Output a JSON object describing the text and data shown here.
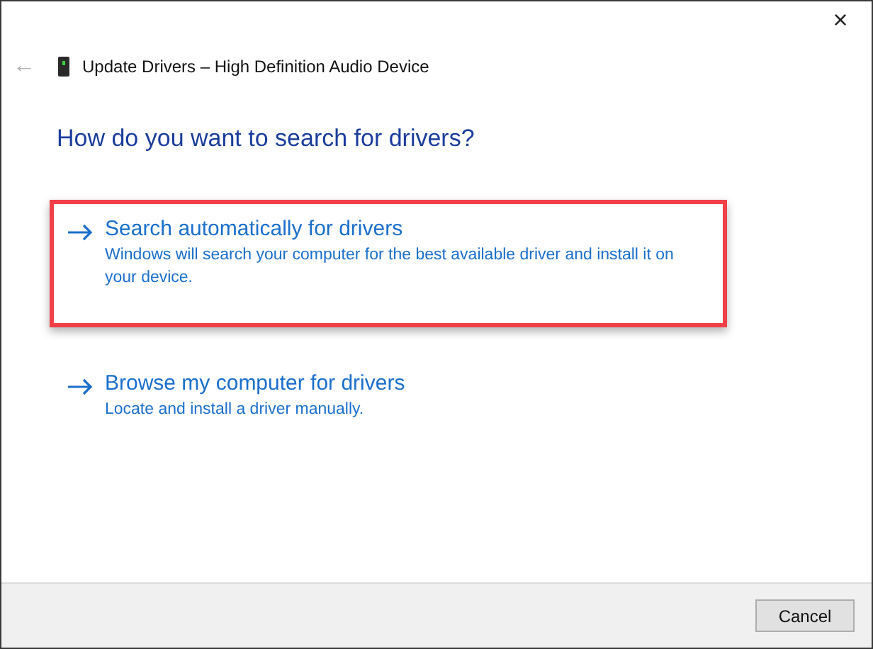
{
  "window": {
    "title": "Update Drivers – High Definition Audio Device",
    "close": "×",
    "back": "←"
  },
  "heading": "How do you want to search for drivers?",
  "options": [
    {
      "title": "Search automatically for drivers",
      "description": "Windows will search your computer for the best available driver and install it on your device.",
      "highlighted": true
    },
    {
      "title": "Browse my computer for drivers",
      "description": "Locate and install a driver manually.",
      "highlighted": false
    }
  ],
  "buttons": [
    "Cancel"
  ]
}
